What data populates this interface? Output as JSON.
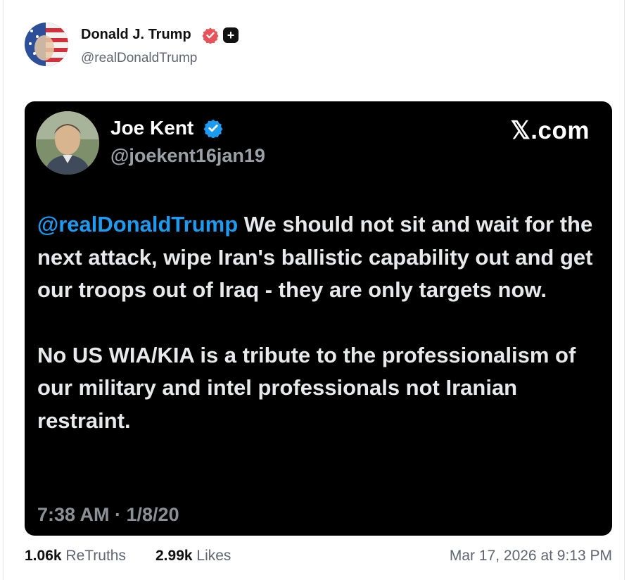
{
  "post": {
    "author_name": "Donald J. Trump",
    "author_handle": "@realDonaldTrump",
    "icons": {
      "verified": "verified-badge-icon",
      "plus": "plus-badge-icon"
    },
    "accent_color": "#e8535b"
  },
  "embed": {
    "author_name": "Joe Kent",
    "author_handle": "@joekent16jan19",
    "source": "𝕏.com",
    "mention": "@realDonaldTrump",
    "paragraph1_rest": " We should not sit and wait for the next attack, wipe Iran's ballistic capability out and get our troops out of Iraq - they are only targets now.",
    "paragraph2": "No US WIA/KIA is a tribute to the professionalism of our military and intel professionals not Iranian restraint.",
    "timestamp": "7:38 AM · 1/8/20",
    "mention_color": "#1d9bf0",
    "verified_color": "#1d9bf0"
  },
  "footer": {
    "retruths_count": "1.06k",
    "retruths_label": " ReTruths",
    "likes_count": "2.99k",
    "likes_label": " Likes",
    "date": "Mar 17, 2026 at 9:13 PM"
  }
}
